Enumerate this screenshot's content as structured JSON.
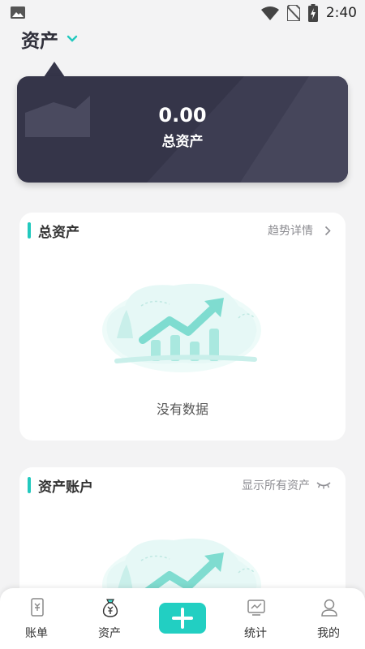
{
  "status_bar": {
    "time": "2:40"
  },
  "header": {
    "title": "资产"
  },
  "summary": {
    "amount": "0.00",
    "label": "总资产"
  },
  "total_card": {
    "title": "总资产",
    "link": "趋势详情",
    "empty_text": "没有数据"
  },
  "accounts_card": {
    "title": "资产账户",
    "link": "显示所有资产"
  },
  "tabbar": {
    "items": [
      {
        "label": "账单",
        "icon": "bill-icon"
      },
      {
        "label": "资产",
        "icon": "money-bag-icon"
      },
      {
        "label": "",
        "icon": "plus-icon"
      },
      {
        "label": "统计",
        "icon": "chart-icon"
      },
      {
        "label": "我的",
        "icon": "profile-icon"
      }
    ]
  },
  "colors": {
    "accent": "#22cfc2",
    "card_dark": "#353549",
    "background": "#f3f3f4"
  }
}
